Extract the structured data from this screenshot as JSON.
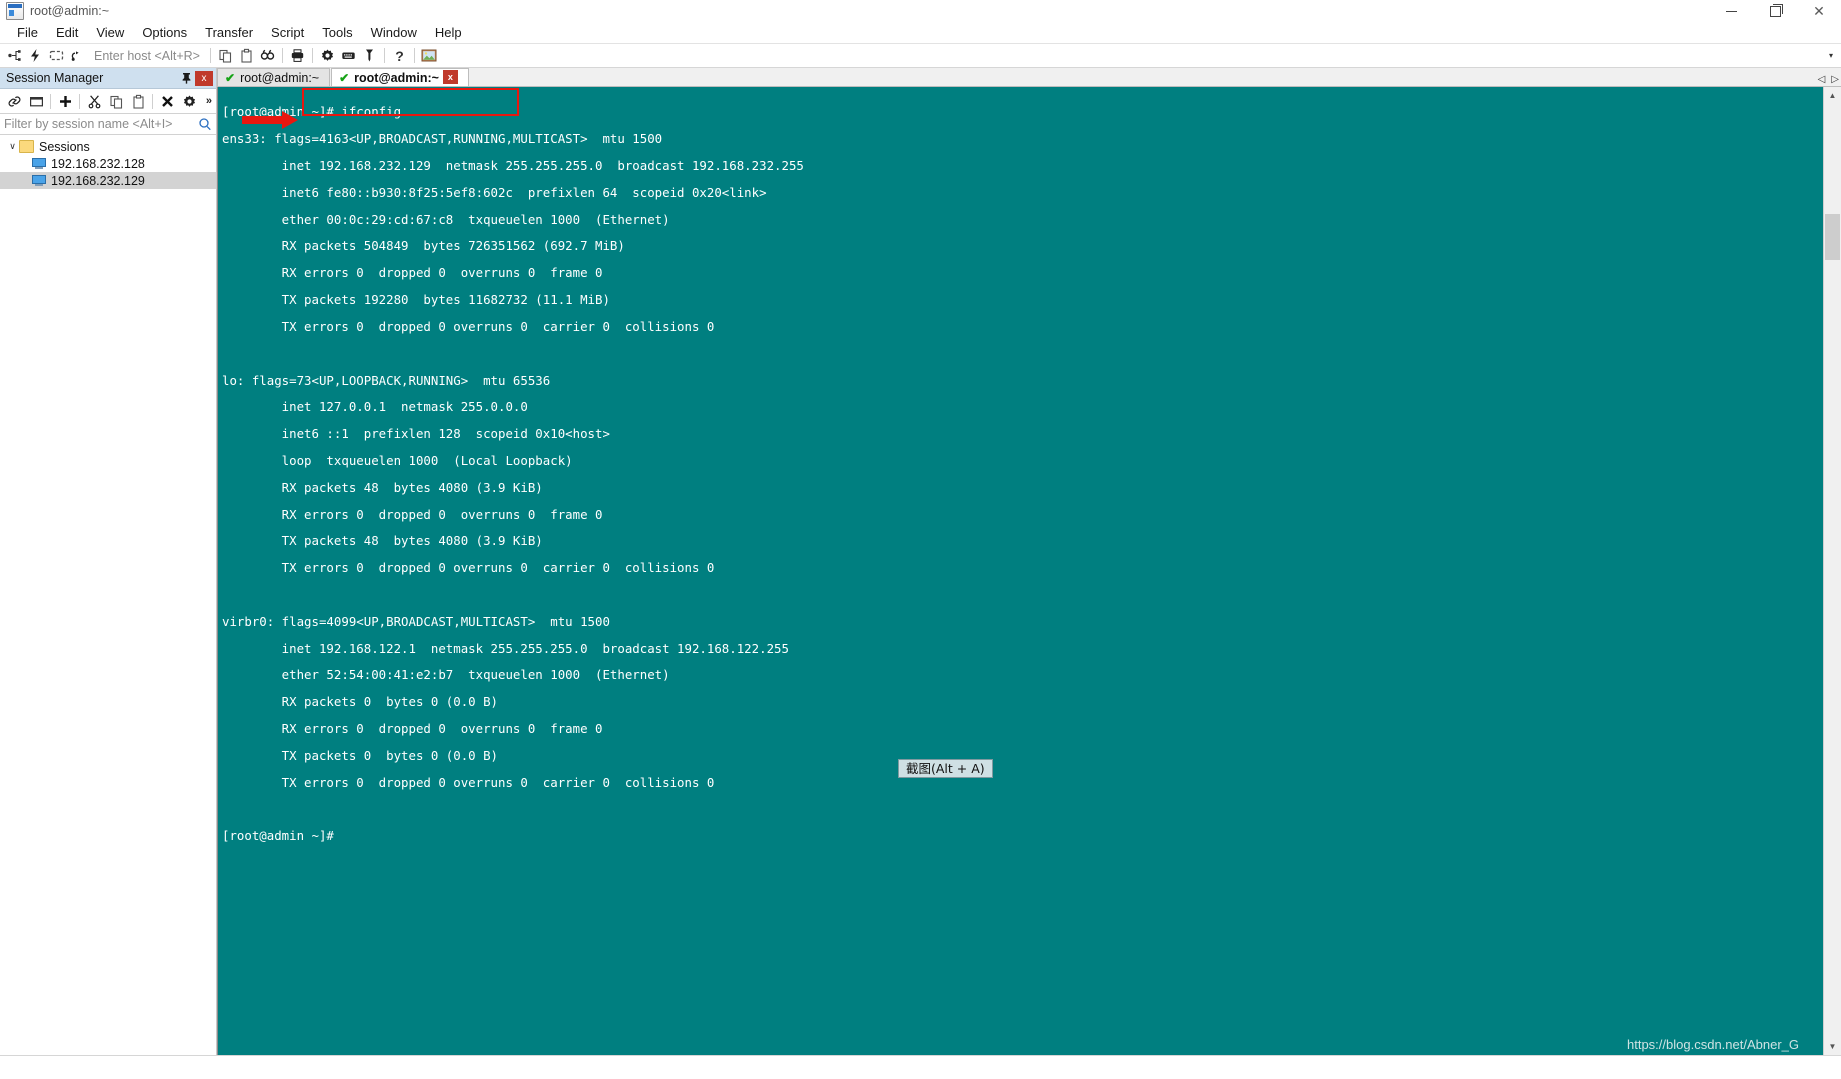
{
  "window": {
    "title": "root@admin:~",
    "app_icon": "securecrt-icon",
    "controls": {
      "minimize": "—",
      "maximize": "❐",
      "close": "✕"
    }
  },
  "menu": {
    "items": [
      "File",
      "Edit",
      "View",
      "Options",
      "Transfer",
      "Script",
      "Tools",
      "Window",
      "Help"
    ]
  },
  "toolbar": {
    "host_placeholder": "Enter host <Alt+R>",
    "buttons": [
      {
        "name": "connect-icon"
      },
      {
        "name": "quick-connect-icon"
      },
      {
        "name": "connect-in-tab-icon"
      },
      {
        "name": "reconnect-icon"
      },
      {
        "name": "copy-icon"
      },
      {
        "name": "paste-icon"
      },
      {
        "name": "find-icon"
      },
      {
        "name": "print-icon"
      },
      {
        "name": "session-options-icon"
      },
      {
        "name": "keymap-editor-icon"
      },
      {
        "name": "key-icon"
      },
      {
        "name": "help-icon"
      },
      {
        "name": "screenshot-icon"
      }
    ],
    "overflow_caret": "▾"
  },
  "sidebar": {
    "title": "Session Manager",
    "pin_icon": "pin-icon",
    "close_label": "x",
    "tools": [
      {
        "name": "connect-link-icon"
      },
      {
        "name": "new-folder-icon"
      },
      {
        "name": "new-session-icon"
      },
      {
        "name": "cut-icon"
      },
      {
        "name": "copy-icon"
      },
      {
        "name": "paste-icon"
      },
      {
        "name": "delete-icon"
      },
      {
        "name": "properties-icon"
      }
    ],
    "overflow": "»",
    "filter_placeholder": "Filter by session name <Alt+I>",
    "search_icon": "search-icon",
    "tree": {
      "root_label": "Sessions",
      "expand_glyph": "∨",
      "sessions": [
        {
          "label": "192.168.232.128",
          "selected": false
        },
        {
          "label": "192.168.232.129",
          "selected": true
        }
      ]
    }
  },
  "tabs": [
    {
      "label": "root@admin:~",
      "active": false,
      "status_icon": "check-icon"
    },
    {
      "label": "root@admin:~",
      "active": true,
      "status_icon": "check-icon"
    }
  ],
  "tab_close_label": "x",
  "tab_nav": {
    "prev": "◁",
    "next": "▷"
  },
  "terminal": {
    "background_color": "#007f80",
    "foreground_color": "#ffffff",
    "lines": [
      "[root@admin ~]# ifconfig",
      "ens33: flags=4163<UP,BROADCAST,RUNNING,MULTICAST>  mtu 1500",
      "        inet 192.168.232.129  netmask 255.255.255.0  broadcast 192.168.232.255",
      "        inet6 fe80::b930:8f25:5ef8:602c  prefixlen 64  scopeid 0x20<link>",
      "        ether 00:0c:29:cd:67:c8  txqueuelen 1000  (Ethernet)",
      "        RX packets 504849  bytes 726351562 (692.7 MiB)",
      "        RX errors 0  dropped 0  overruns 0  frame 0",
      "        TX packets 192280  bytes 11682732 (11.1 MiB)",
      "        TX errors 0  dropped 0 overruns 0  carrier 0  collisions 0",
      "",
      "lo: flags=73<UP,LOOPBACK,RUNNING>  mtu 65536",
      "        inet 127.0.0.1  netmask 255.0.0.0",
      "        inet6 ::1  prefixlen 128  scopeid 0x10<host>",
      "        loop  txqueuelen 1000  (Local Loopback)",
      "        RX packets 48  bytes 4080 (3.9 KiB)",
      "        RX errors 0  dropped 0  overruns 0  frame 0",
      "        TX packets 48  bytes 4080 (3.9 KiB)",
      "        TX errors 0  dropped 0 overruns 0  carrier 0  collisions 0",
      "",
      "virbr0: flags=4099<UP,BROADCAST,MULTICAST>  mtu 1500",
      "        inet 192.168.122.1  netmask 255.255.255.0  broadcast 192.168.122.255",
      "        ether 52:54:00:41:e2:b7  txqueuelen 1000  (Ethernet)",
      "        RX packets 0  bytes 0 (0.0 B)",
      "        RX errors 0  dropped 0  overruns 0  frame 0",
      "        TX packets 0  bytes 0 (0.0 B)",
      "        TX errors 0  dropped 0 overruns 0  carrier 0  collisions 0",
      "",
      "[root@admin ~]#"
    ]
  },
  "annotations": {
    "highlight_color": "#e8170f",
    "box_target": "ifconfig-command",
    "arrow_target": "inet-address-line"
  },
  "tooltip": {
    "text": "截图(Alt + A)"
  },
  "watermark": {
    "text": "https://blog.csdn.net/Abner_G"
  },
  "scrollbar": {
    "up": "▲",
    "down": "▼"
  }
}
